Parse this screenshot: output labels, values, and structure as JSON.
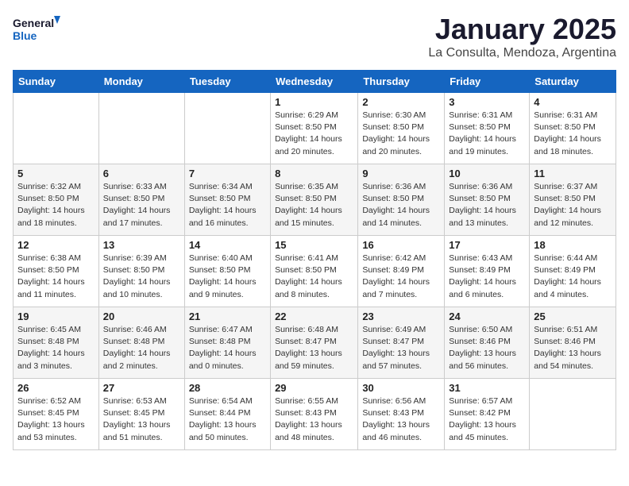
{
  "header": {
    "logo_general": "General",
    "logo_blue": "Blue",
    "title": "January 2025",
    "subtitle": "La Consulta, Mendoza, Argentina"
  },
  "days_of_week": [
    "Sunday",
    "Monday",
    "Tuesday",
    "Wednesday",
    "Thursday",
    "Friday",
    "Saturday"
  ],
  "weeks": [
    [
      {
        "day": null
      },
      {
        "day": null
      },
      {
        "day": null
      },
      {
        "day": 1,
        "sunrise": "6:29 AM",
        "sunset": "8:50 PM",
        "daylight": "14 hours and 20 minutes."
      },
      {
        "day": 2,
        "sunrise": "6:30 AM",
        "sunset": "8:50 PM",
        "daylight": "14 hours and 20 minutes."
      },
      {
        "day": 3,
        "sunrise": "6:31 AM",
        "sunset": "8:50 PM",
        "daylight": "14 hours and 19 minutes."
      },
      {
        "day": 4,
        "sunrise": "6:31 AM",
        "sunset": "8:50 PM",
        "daylight": "14 hours and 18 minutes."
      }
    ],
    [
      {
        "day": 5,
        "sunrise": "6:32 AM",
        "sunset": "8:50 PM",
        "daylight": "14 hours and 18 minutes."
      },
      {
        "day": 6,
        "sunrise": "6:33 AM",
        "sunset": "8:50 PM",
        "daylight": "14 hours and 17 minutes."
      },
      {
        "day": 7,
        "sunrise": "6:34 AM",
        "sunset": "8:50 PM",
        "daylight": "14 hours and 16 minutes."
      },
      {
        "day": 8,
        "sunrise": "6:35 AM",
        "sunset": "8:50 PM",
        "daylight": "14 hours and 15 minutes."
      },
      {
        "day": 9,
        "sunrise": "6:36 AM",
        "sunset": "8:50 PM",
        "daylight": "14 hours and 14 minutes."
      },
      {
        "day": 10,
        "sunrise": "6:36 AM",
        "sunset": "8:50 PM",
        "daylight": "14 hours and 13 minutes."
      },
      {
        "day": 11,
        "sunrise": "6:37 AM",
        "sunset": "8:50 PM",
        "daylight": "14 hours and 12 minutes."
      }
    ],
    [
      {
        "day": 12,
        "sunrise": "6:38 AM",
        "sunset": "8:50 PM",
        "daylight": "14 hours and 11 minutes."
      },
      {
        "day": 13,
        "sunrise": "6:39 AM",
        "sunset": "8:50 PM",
        "daylight": "14 hours and 10 minutes."
      },
      {
        "day": 14,
        "sunrise": "6:40 AM",
        "sunset": "8:50 PM",
        "daylight": "14 hours and 9 minutes."
      },
      {
        "day": 15,
        "sunrise": "6:41 AM",
        "sunset": "8:50 PM",
        "daylight": "14 hours and 8 minutes."
      },
      {
        "day": 16,
        "sunrise": "6:42 AM",
        "sunset": "8:49 PM",
        "daylight": "14 hours and 7 minutes."
      },
      {
        "day": 17,
        "sunrise": "6:43 AM",
        "sunset": "8:49 PM",
        "daylight": "14 hours and 6 minutes."
      },
      {
        "day": 18,
        "sunrise": "6:44 AM",
        "sunset": "8:49 PM",
        "daylight": "14 hours and 4 minutes."
      }
    ],
    [
      {
        "day": 19,
        "sunrise": "6:45 AM",
        "sunset": "8:48 PM",
        "daylight": "14 hours and 3 minutes."
      },
      {
        "day": 20,
        "sunrise": "6:46 AM",
        "sunset": "8:48 PM",
        "daylight": "14 hours and 2 minutes."
      },
      {
        "day": 21,
        "sunrise": "6:47 AM",
        "sunset": "8:48 PM",
        "daylight": "14 hours and 0 minutes."
      },
      {
        "day": 22,
        "sunrise": "6:48 AM",
        "sunset": "8:47 PM",
        "daylight": "13 hours and 59 minutes."
      },
      {
        "day": 23,
        "sunrise": "6:49 AM",
        "sunset": "8:47 PM",
        "daylight": "13 hours and 57 minutes."
      },
      {
        "day": 24,
        "sunrise": "6:50 AM",
        "sunset": "8:46 PM",
        "daylight": "13 hours and 56 minutes."
      },
      {
        "day": 25,
        "sunrise": "6:51 AM",
        "sunset": "8:46 PM",
        "daylight": "13 hours and 54 minutes."
      }
    ],
    [
      {
        "day": 26,
        "sunrise": "6:52 AM",
        "sunset": "8:45 PM",
        "daylight": "13 hours and 53 minutes."
      },
      {
        "day": 27,
        "sunrise": "6:53 AM",
        "sunset": "8:45 PM",
        "daylight": "13 hours and 51 minutes."
      },
      {
        "day": 28,
        "sunrise": "6:54 AM",
        "sunset": "8:44 PM",
        "daylight": "13 hours and 50 minutes."
      },
      {
        "day": 29,
        "sunrise": "6:55 AM",
        "sunset": "8:43 PM",
        "daylight": "13 hours and 48 minutes."
      },
      {
        "day": 30,
        "sunrise": "6:56 AM",
        "sunset": "8:43 PM",
        "daylight": "13 hours and 46 minutes."
      },
      {
        "day": 31,
        "sunrise": "6:57 AM",
        "sunset": "8:42 PM",
        "daylight": "13 hours and 45 minutes."
      },
      {
        "day": null
      }
    ]
  ]
}
